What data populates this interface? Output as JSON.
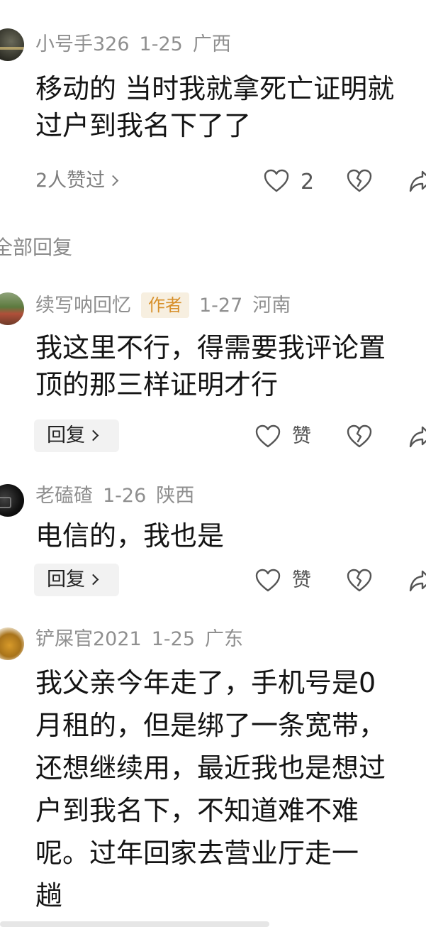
{
  "comment_top": {
    "username": "小号手326",
    "date": "1-25",
    "location": "广西",
    "text_lines": [
      "移动的 当时我就拿死亡证明就",
      "过户到我名下了了"
    ],
    "likers": "2人赞过",
    "like_count": "2"
  },
  "section_title": "全部回复",
  "replies": [
    {
      "username": "续写呐回忆",
      "badge": "作者",
      "date": "1-27",
      "location": "河南",
      "text_lines": [
        "我这里不行，得需要我评论置",
        "顶的那三样证明才行"
      ],
      "reply_label": "回复",
      "like_label": "赞"
    },
    {
      "username": "老磕碴",
      "date": "1-26",
      "location": "陕西",
      "text_lines": [
        "电信的，我也是"
      ],
      "reply_label": "回复",
      "like_label": "赞"
    },
    {
      "username": "铲屎官2021",
      "date": "1-25",
      "location": "广东",
      "text_lines": [
        "我父亲今年走了，手机号是0",
        "月租的，但是绑了一条宽带，",
        "还想继续用，最近我也是想过",
        "户到我名下，不知道难不难",
        "呢。过年回家去营业厅走一",
        "趟"
      ]
    }
  ],
  "icons": {
    "like": "heart-outline-icon",
    "dislike": "broken-heart-icon",
    "share": "share-arrow-icon",
    "chevron": "chevron-right-icon"
  }
}
